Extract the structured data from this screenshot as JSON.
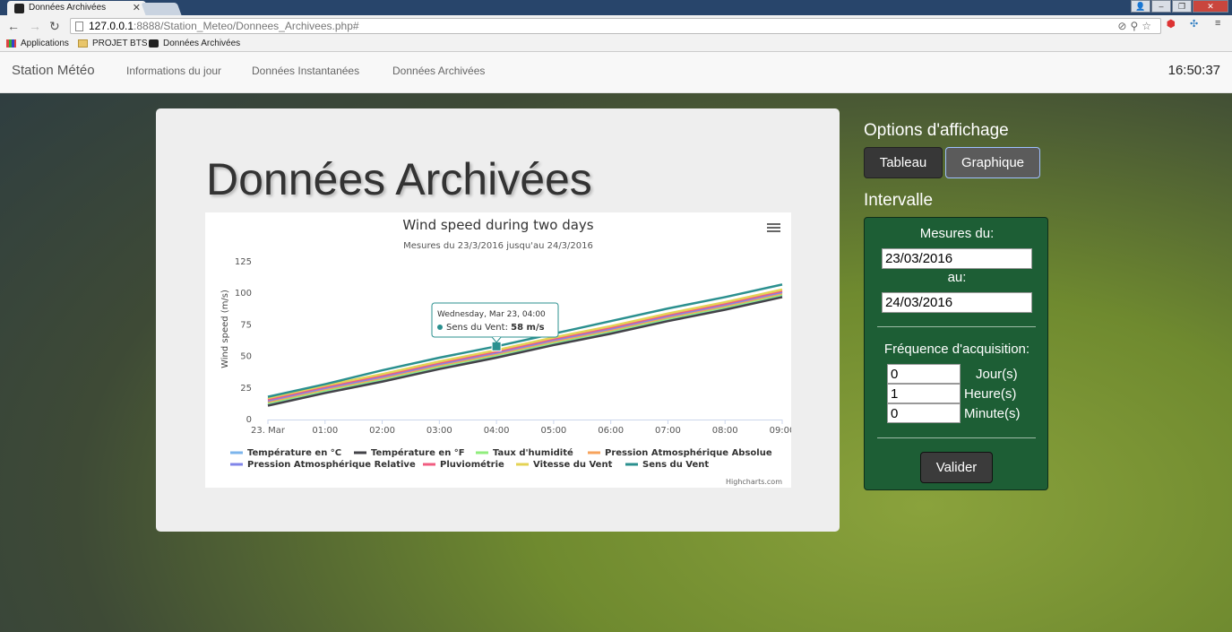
{
  "browser": {
    "tab_title": "Données Archivées",
    "url_host": "127.0.0.1",
    "url_path": ":8888/Station_Meteo/Donnees_Archivees.php#",
    "bookmarks": [
      "Applications",
      "PROJET BTS",
      "Données Archivées"
    ]
  },
  "nav": {
    "brand": "Station Météo",
    "links": [
      "Informations du jour",
      "Données Instantanées",
      "Données Archivées"
    ],
    "clock": "16:50:37"
  },
  "page_title": "Données Archivées",
  "options": {
    "title": "Options d'affichage",
    "tableau": "Tableau",
    "graphique": "Graphique"
  },
  "interval": {
    "title": "Intervalle",
    "from_label": "Mesures du:",
    "from_value": "23/03/2016",
    "to_label": "au:",
    "to_value": "24/03/2016",
    "freq_label": "Fréquence d'acquisition:",
    "days_value": "0",
    "days_unit": "Jour(s)",
    "hours_value": "1",
    "hours_unit": "Heure(s)",
    "minutes_value": "0",
    "minutes_unit": "Minute(s)",
    "submit": "Valider"
  },
  "chart_data": {
    "type": "line",
    "title": "Wind speed during two days",
    "subtitle": "Mesures du 23/3/2016 jusqu'au 24/3/2016",
    "ylabel": "Wind speed (m/s)",
    "xlabel": "",
    "ylim": [
      0,
      125
    ],
    "yticks": [
      0,
      25,
      50,
      75,
      100,
      125
    ],
    "x": [
      "23. Mar",
      "01:00",
      "02:00",
      "03:00",
      "04:00",
      "05:00",
      "06:00",
      "07:00",
      "08:00",
      "09:00"
    ],
    "grid": false,
    "legend": "bottom",
    "credits": "Highcharts.com",
    "tooltip": {
      "date": "Wednesday, Mar 23, 04:00",
      "series": "Sens du Vent",
      "value": "58 m/s"
    },
    "series": [
      {
        "name": "Température en °C",
        "color": "#7cb5ec",
        "values": [
          12,
          22,
          31,
          41,
          50,
          60,
          69,
          79,
          88,
          98
        ]
      },
      {
        "name": "Température en °F",
        "color": "#434348",
        "values": [
          11,
          21,
          30,
          40,
          49,
          59,
          68,
          78,
          87,
          97
        ]
      },
      {
        "name": "Taux d'humidité",
        "color": "#90ed7d",
        "values": [
          13,
          23,
          32,
          42,
          51,
          61,
          70,
          80,
          89,
          99
        ]
      },
      {
        "name": "Pression Atmosphérique Absolue",
        "color": "#f7a35c",
        "values": [
          14,
          24,
          33,
          43,
          52,
          62,
          71,
          81,
          90,
          100
        ]
      },
      {
        "name": "Pression Atmosphérique Relative",
        "color": "#8085e9",
        "values": [
          15,
          25,
          34,
          44,
          53,
          63,
          72,
          82,
          91,
          101
        ]
      },
      {
        "name": "Pluviométrie",
        "color": "#f15c80",
        "values": [
          16,
          26,
          35,
          45,
          54,
          64,
          73,
          83,
          92,
          102
        ]
      },
      {
        "name": "Vitesse du Vent",
        "color": "#e4d354",
        "values": [
          17,
          27,
          36,
          46,
          55,
          65,
          74,
          84,
          93,
          103
        ]
      },
      {
        "name": "Sens du Vent",
        "color": "#2b908f",
        "values": [
          18,
          28,
          39,
          49,
          58,
          68,
          78,
          88,
          97,
          107
        ]
      }
    ]
  }
}
